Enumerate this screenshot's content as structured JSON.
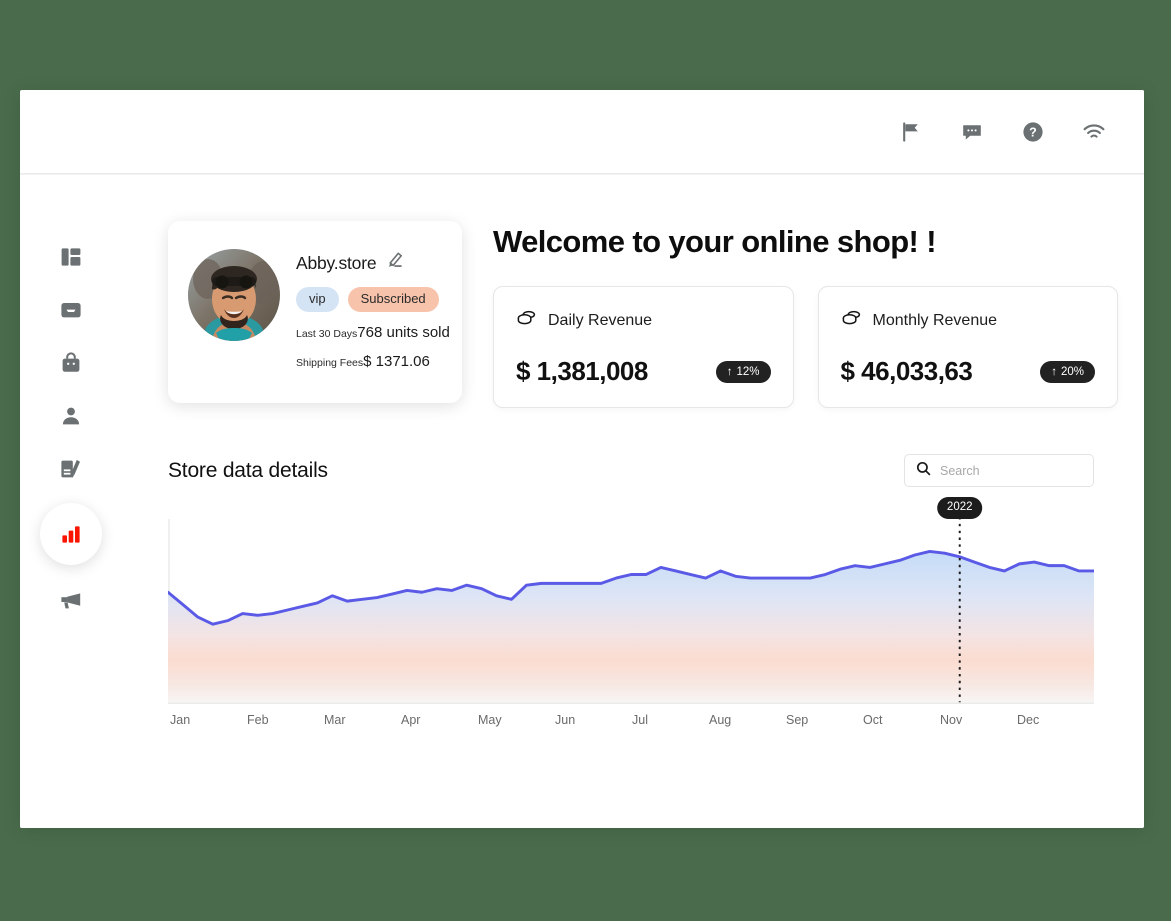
{
  "theme": {
    "page_background": "#4a6c4c",
    "accent_red": "#fb1400",
    "chart_line": "#5a5ae6",
    "badge_vip_bg": "#d5e4f5",
    "badge_subscribed_bg": "#f8c3ab",
    "delta_pill_bg": "#222222"
  },
  "topbar": {
    "icons": [
      {
        "name": "flag-icon",
        "label": "Flag"
      },
      {
        "name": "chat-icon",
        "label": "Messages"
      },
      {
        "name": "help-icon",
        "label": "Help"
      },
      {
        "name": "wifi-icon",
        "label": "Connection"
      }
    ]
  },
  "sidebar": {
    "items": [
      {
        "name": "sidebar-item-dashboard",
        "icon": "layout-icon",
        "label": "Dashboard",
        "active": false
      },
      {
        "name": "sidebar-item-inbox",
        "icon": "inbox-icon",
        "label": "Inbox",
        "active": false
      },
      {
        "name": "sidebar-item-shop",
        "icon": "shopping-bag-icon",
        "label": "Shop",
        "active": false
      },
      {
        "name": "sidebar-item-customers",
        "icon": "person-icon",
        "label": "Customers",
        "active": false
      },
      {
        "name": "sidebar-item-content",
        "icon": "document-pen-icon",
        "label": "Content",
        "active": false
      },
      {
        "name": "sidebar-item-analytics",
        "icon": "bar-chart-icon",
        "label": "Analytics",
        "active": true
      },
      {
        "name": "sidebar-item-marketing",
        "icon": "megaphone-icon",
        "label": "Marketing",
        "active": false
      }
    ]
  },
  "profile": {
    "store_name": "Abby.store",
    "edit_icon": "pencil-icon",
    "avatar_alt": "Store owner portrait",
    "badges": [
      {
        "label": "vip",
        "style": "vip"
      },
      {
        "label": "Subscribed",
        "style": "subscribed"
      }
    ],
    "stats": [
      {
        "label": "Last 30 Days",
        "value": "768 units sold"
      },
      {
        "label": "Shipping Fees",
        "value": "$ 1371.06"
      }
    ]
  },
  "main": {
    "welcome_title": "Welcome to your online shop! !",
    "revenue_cards": [
      {
        "icon": "coins-icon",
        "title": "Daily Revenue",
        "amount": "$ 1,381,008",
        "delta": "12%",
        "delta_direction": "↑"
      },
      {
        "icon": "coins-icon",
        "title": "Monthly Revenue",
        "amount": "$ 46,033,63",
        "delta": "20%",
        "delta_direction": "↑"
      }
    ],
    "store_section": {
      "title": "Store data details",
      "search_placeholder": "Search",
      "search_value": "",
      "search_icon": "search-icon"
    }
  },
  "chart_data": {
    "type": "area",
    "title": "Store data details",
    "xlabel": "",
    "ylabel": "",
    "grid": false,
    "legend": "none",
    "x_tick_labels": [
      "Jan",
      "Feb",
      "Mar",
      "Apr",
      "May",
      "Jun",
      "Jul",
      "Aug",
      "Sep",
      "Oct",
      "Nov",
      "Dec"
    ],
    "annotation": {
      "label": "2022",
      "at_x_fraction": 0.855,
      "style": "dotted-vertical-marker"
    },
    "series": [
      {
        "name": "Revenue",
        "color": "#5a5ae6",
        "fill": "gradient blue-to-peach",
        "values": [
          62,
          55,
          48,
          44,
          46,
          50,
          49,
          50,
          52,
          54,
          56,
          60,
          57,
          58,
          59,
          61,
          63,
          62,
          64,
          63,
          66,
          64,
          60,
          58,
          66,
          67,
          67,
          67,
          67,
          67,
          70,
          72,
          72,
          76,
          74,
          72,
          70,
          74,
          71,
          70,
          70,
          70,
          70,
          70,
          72,
          75,
          77,
          76,
          78,
          80,
          83,
          85,
          84,
          82,
          79,
          76,
          74,
          78,
          79,
          77,
          77,
          74,
          74
        ],
        "ylim": [
          0,
          100
        ]
      }
    ]
  }
}
